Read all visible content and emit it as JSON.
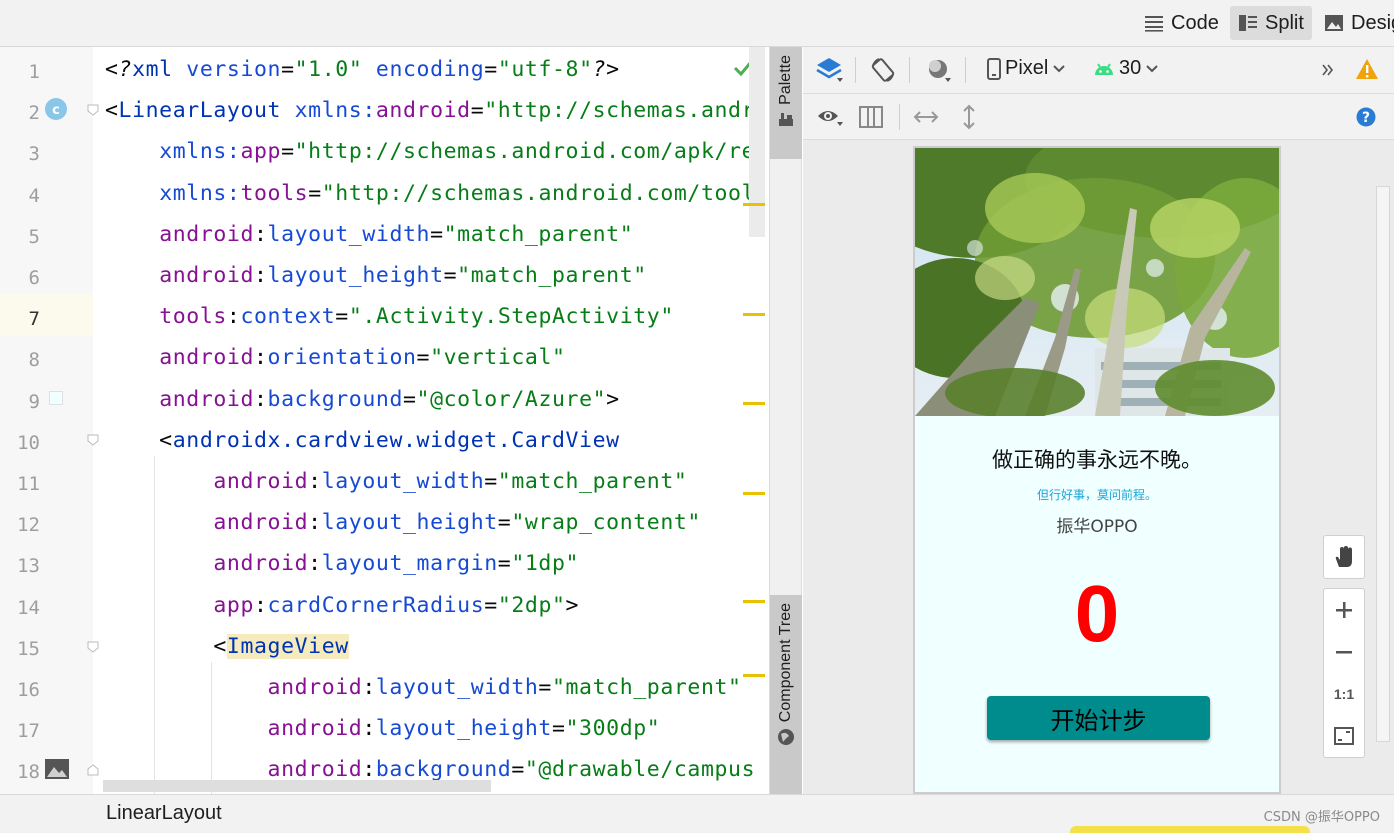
{
  "toolbar": {
    "code_label": "Code",
    "split_label": "Split",
    "design_label": "Desig"
  },
  "editor": {
    "lines": [
      {
        "num": "1",
        "tokens": [
          [
            "plain",
            "<"
          ],
          [
            "ital",
            "?"
          ],
          [
            "tag",
            "xml "
          ],
          [
            "attr",
            "version"
          ],
          [
            "plain",
            "="
          ],
          [
            "str",
            "\"1.0\" "
          ],
          [
            "attr",
            "encoding"
          ],
          [
            "plain",
            "="
          ],
          [
            "str",
            "\"utf-8\""
          ],
          [
            "ital",
            "?"
          ],
          [
            "plain",
            ">"
          ]
        ]
      },
      {
        "num": "2",
        "tokens": [
          [
            "plain",
            "<"
          ],
          [
            "tag",
            "LinearLayout "
          ],
          [
            "attr",
            "xmlns:"
          ],
          [
            "ns",
            "android"
          ],
          [
            "plain",
            "="
          ],
          [
            "str",
            "\"http://schemas.andr"
          ]
        ]
      },
      {
        "num": "3",
        "tokens": [
          [
            "plain",
            "    "
          ],
          [
            "attr",
            "xmlns:"
          ],
          [
            "ns",
            "app"
          ],
          [
            "plain",
            "="
          ],
          [
            "str",
            "\"http://schemas.android.com/apk/re"
          ]
        ]
      },
      {
        "num": "4",
        "tokens": [
          [
            "plain",
            "    "
          ],
          [
            "attr",
            "xmlns:"
          ],
          [
            "ns",
            "tools"
          ],
          [
            "plain",
            "="
          ],
          [
            "str",
            "\"http://schemas.android.com/tool"
          ]
        ]
      },
      {
        "num": "5",
        "tokens": [
          [
            "plain",
            "    "
          ],
          [
            "ns",
            "android"
          ],
          [
            "plain",
            ":"
          ],
          [
            "attr",
            "layout_width"
          ],
          [
            "plain",
            "="
          ],
          [
            "str",
            "\"match_parent\""
          ]
        ]
      },
      {
        "num": "6",
        "tokens": [
          [
            "plain",
            "    "
          ],
          [
            "ns",
            "android"
          ],
          [
            "plain",
            ":"
          ],
          [
            "attr",
            "layout_height"
          ],
          [
            "plain",
            "="
          ],
          [
            "str",
            "\"match_parent\""
          ]
        ]
      },
      {
        "num": "7",
        "tokens": [
          [
            "plain",
            "    "
          ],
          [
            "ns",
            "tools"
          ],
          [
            "plain",
            ":"
          ],
          [
            "attr",
            "context"
          ],
          [
            "plain",
            "="
          ],
          [
            "str",
            "\".Activity.StepActivity\""
          ]
        ]
      },
      {
        "num": "8",
        "tokens": [
          [
            "plain",
            "    "
          ],
          [
            "ns",
            "android"
          ],
          [
            "plain",
            ":"
          ],
          [
            "attr",
            "orientation"
          ],
          [
            "plain",
            "="
          ],
          [
            "str",
            "\"vertical\""
          ]
        ]
      },
      {
        "num": "9",
        "tokens": [
          [
            "plain",
            "    "
          ],
          [
            "ns",
            "android"
          ],
          [
            "plain",
            ":"
          ],
          [
            "attr",
            "background"
          ],
          [
            "plain",
            "="
          ],
          [
            "str",
            "\"@color/Azure\""
          ],
          [
            "plain",
            ">"
          ]
        ]
      },
      {
        "num": "10",
        "tokens": [
          [
            "plain",
            "    <"
          ],
          [
            "tag",
            "androidx.cardview.widget.CardView"
          ]
        ]
      },
      {
        "num": "11",
        "tokens": [
          [
            "plain",
            "        "
          ],
          [
            "ns",
            "android"
          ],
          [
            "plain",
            ":"
          ],
          [
            "attr",
            "layout_width"
          ],
          [
            "plain",
            "="
          ],
          [
            "str",
            "\"match_parent\""
          ]
        ]
      },
      {
        "num": "12",
        "tokens": [
          [
            "plain",
            "        "
          ],
          [
            "ns",
            "android"
          ],
          [
            "plain",
            ":"
          ],
          [
            "attr",
            "layout_height"
          ],
          [
            "plain",
            "="
          ],
          [
            "str",
            "\"wrap_content\""
          ]
        ]
      },
      {
        "num": "13",
        "tokens": [
          [
            "plain",
            "        "
          ],
          [
            "ns",
            "android"
          ],
          [
            "plain",
            ":"
          ],
          [
            "attr",
            "layout_margin"
          ],
          [
            "plain",
            "="
          ],
          [
            "str",
            "\"1dp\""
          ]
        ]
      },
      {
        "num": "14",
        "tokens": [
          [
            "plain",
            "        "
          ],
          [
            "ns",
            "app"
          ],
          [
            "plain",
            ":"
          ],
          [
            "attr",
            "cardCornerRadius"
          ],
          [
            "plain",
            "="
          ],
          [
            "str",
            "\"2dp\""
          ],
          [
            "plain",
            ">"
          ]
        ]
      },
      {
        "num": "15",
        "tokens": [
          [
            "plain",
            "        <"
          ],
          [
            "taghl",
            "ImageView"
          ]
        ]
      },
      {
        "num": "16",
        "tokens": [
          [
            "plain",
            "            "
          ],
          [
            "ns",
            "android"
          ],
          [
            "plain",
            ":"
          ],
          [
            "attr",
            "layout_width"
          ],
          [
            "plain",
            "="
          ],
          [
            "str",
            "\"match_parent\""
          ]
        ]
      },
      {
        "num": "17",
        "tokens": [
          [
            "plain",
            "            "
          ],
          [
            "ns",
            "android"
          ],
          [
            "plain",
            ":"
          ],
          [
            "attr",
            "layout_height"
          ],
          [
            "plain",
            "="
          ],
          [
            "str",
            "\"300dp\""
          ]
        ]
      },
      {
        "num": "18",
        "tokens": [
          [
            "plain",
            "            "
          ],
          [
            "ns",
            "android"
          ],
          [
            "plain",
            ":"
          ],
          [
            "attr",
            "background"
          ],
          [
            "plain",
            "="
          ],
          [
            "str",
            "\"@drawable/campus"
          ]
        ]
      }
    ]
  },
  "side_tabs": {
    "palette": "Palette",
    "component_tree": "Component Tree"
  },
  "design_toolbar": {
    "device": "Pixel",
    "api_level": "30"
  },
  "preview": {
    "quote_main": "做正确的事永远不晚。",
    "quote_sub": "但行好事，莫问前程。",
    "author": "振华OPPO",
    "step_count": "0",
    "start_button": "开始计步"
  },
  "zoom": {
    "one_to_one": "1:1"
  },
  "statusbar": {
    "breadcrumb": "LinearLayout",
    "watermark": "CSDN @振华OPPO"
  },
  "colors": {
    "accent_teal": "#008c8c",
    "count_red": "#ff0000",
    "azure": "#f0ffff"
  }
}
